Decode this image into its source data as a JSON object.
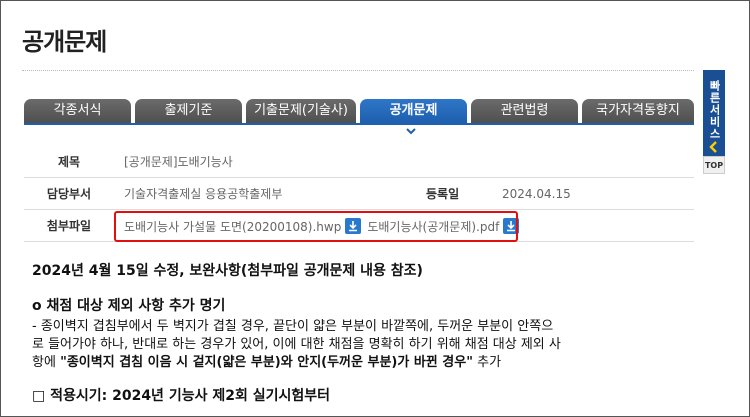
{
  "page_title": "공개문제",
  "tabs": [
    {
      "label": "각종서식"
    },
    {
      "label": "출제기준"
    },
    {
      "label": "기출문제(기술사)"
    },
    {
      "label": "공개문제",
      "active": true
    },
    {
      "label": "관련법령"
    },
    {
      "label": "국가자격동향지"
    }
  ],
  "info": {
    "title_label": "제목",
    "title_value": "[공개문제]도배기능사",
    "dept_label": "담당부서",
    "dept_value": "기술자격출제실 응용공학출제부",
    "date_label": "등록일",
    "date_value": "2024.04.15",
    "attach_label": "첨부파일",
    "files": [
      {
        "name": "도배기능사 가설물 도면(20200108).hwp"
      },
      {
        "name": "도배기능사(공개문제).pdf"
      }
    ]
  },
  "body": {
    "line1": "2024년 4월 15일 수정, 보완사항(첨부파일 공개문제 내용 참조)",
    "line2": "o 채점 대상 제외 사항 추가 명기",
    "line3": "  - 종이벽지 겹침부에서 두 벽지가 겹칠 경우, 끝단이 얇은 부분이 바깥쪽에, 두꺼운 부분이 안쪽으",
    "line4": "로 들어가야 하나, 반대로 하는 경우가 있어, 이에 대한 채점을 명확히 하기 위해 채점 대상 제외 사",
    "line5_a": "항에  ",
    "line5_b": "\"종이벽지 겹침 이음 시 겉지(얇은 부분)와 안지(두꺼운 부분)가 바뀐 경우\"",
    "line5_c": " 추가",
    "line6": "□ 적용시기: 2024년 기능사 제2회 실기시험부터"
  },
  "quick_service": {
    "label": "빠른서비스",
    "top_label": "TOP"
  },
  "colors": {
    "accent": "#1e5fae",
    "tab_inactive": "#5a5a5a",
    "highlight_box": "#e01010",
    "download_icon": "#2a78cc"
  }
}
